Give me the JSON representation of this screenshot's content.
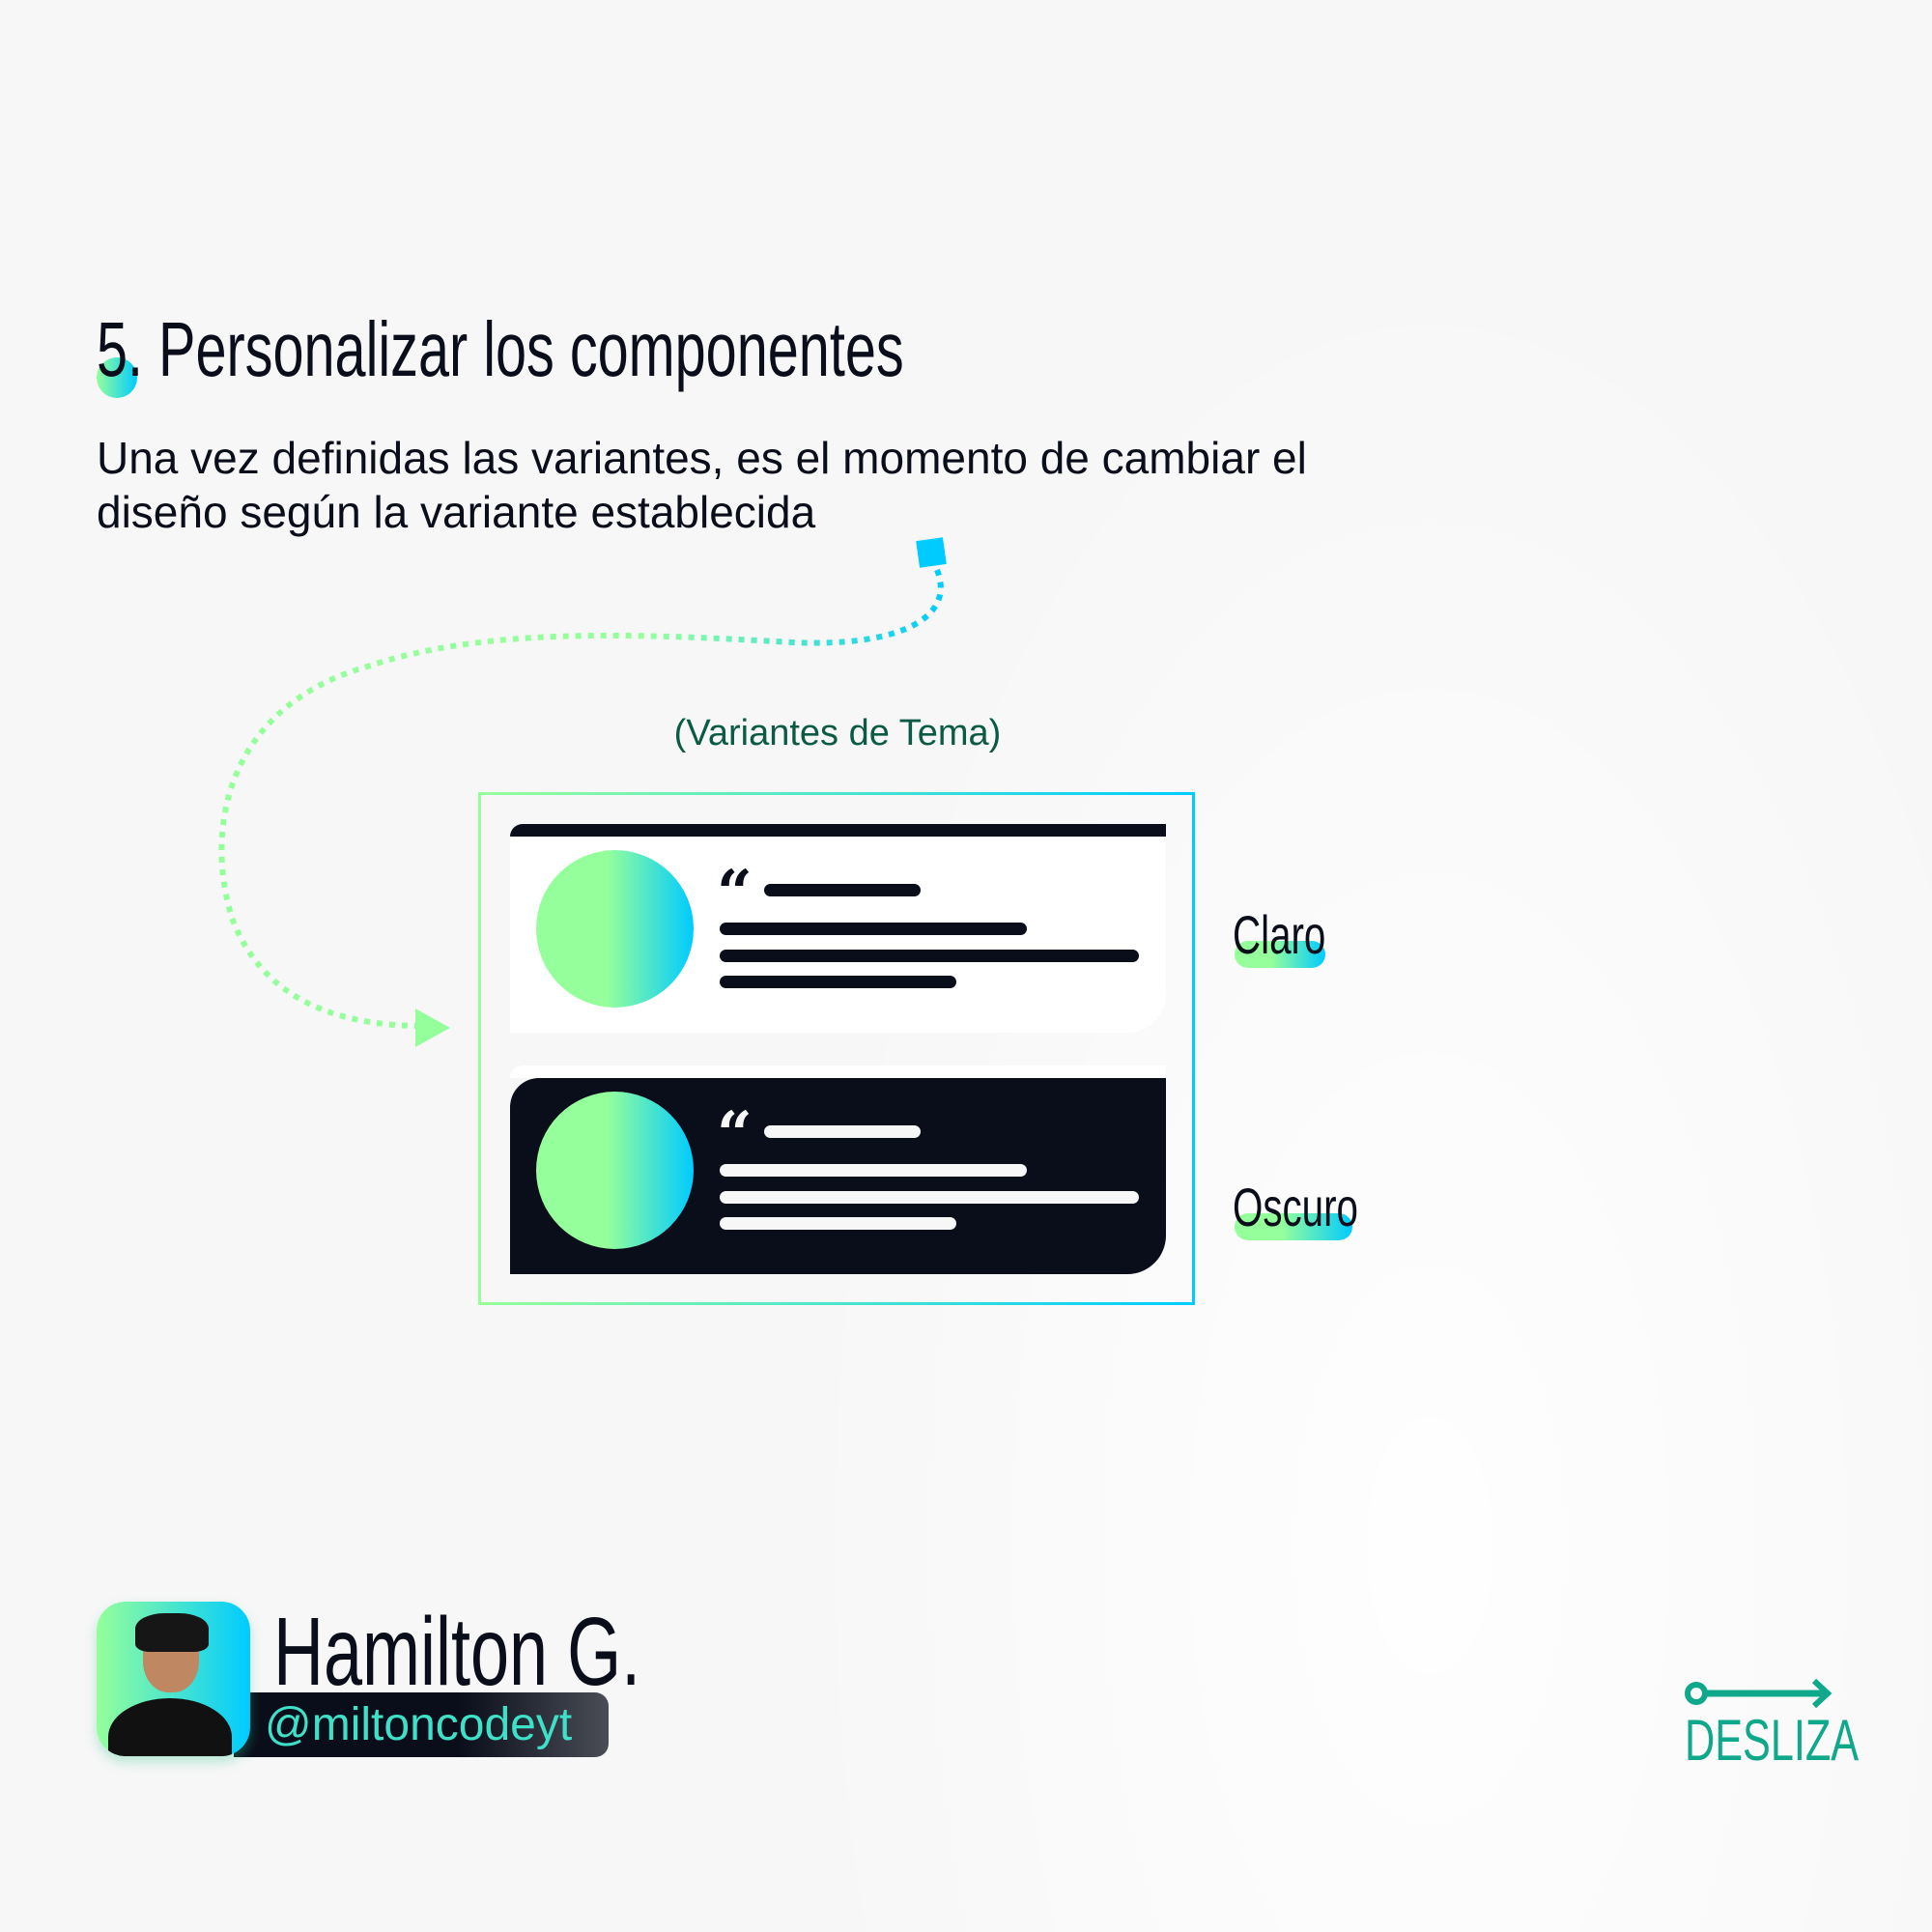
{
  "title": "5. Personalizar los componentes",
  "description": "Una vez definidas las variantes, es el momento de cambiar el diseño según la variante establecida",
  "variants_label": "(Variantes de Tema)",
  "cards": [
    {
      "variant": "Claro",
      "quote": "“"
    },
    {
      "variant": "Oscuro",
      "quote": "“"
    }
  ],
  "author": {
    "name": "Hamilton G.",
    "handle": "@miltoncodeyt"
  },
  "swipe": {
    "label": "DESLIZA"
  },
  "colors": {
    "accent_green": "#95ff9b",
    "accent_cyan": "#00cbff",
    "dark": "#0a0e1a",
    "teal": "#10a88a"
  }
}
